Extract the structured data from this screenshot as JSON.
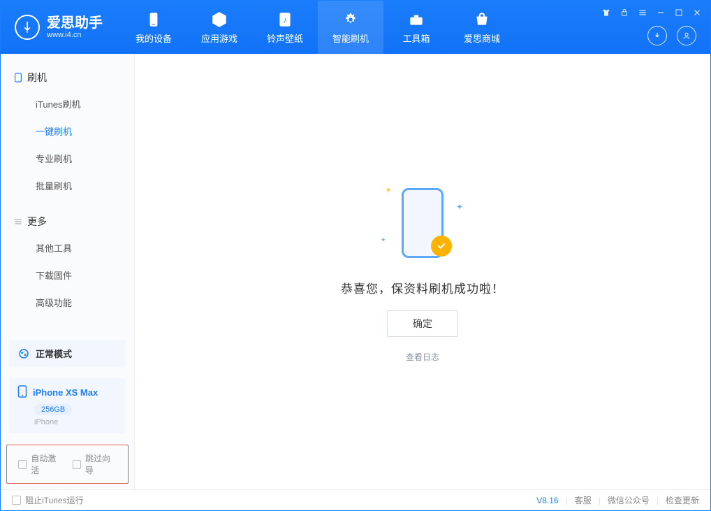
{
  "brand": {
    "name": "爱思助手",
    "site": "www.i4.cn"
  },
  "tabs": [
    {
      "label": "我的设备"
    },
    {
      "label": "应用游戏"
    },
    {
      "label": "铃声壁纸"
    },
    {
      "label": "智能刷机"
    },
    {
      "label": "工具箱"
    },
    {
      "label": "爱思商城"
    }
  ],
  "active_tab_index": 3,
  "sidebar": {
    "groups": [
      {
        "title": "刷机",
        "items": [
          "iTunes刷机",
          "一键刷机",
          "专业刷机",
          "批量刷机"
        ],
        "active_index": 1
      },
      {
        "title": "更多",
        "items": [
          "其他工具",
          "下载固件",
          "高级功能"
        ],
        "active_index": -1
      }
    ],
    "mode": "正常模式",
    "device": {
      "name": "iPhone XS Max",
      "storage": "256GB",
      "type": "iPhone"
    },
    "checkboxes": {
      "auto_activate": "自动激活",
      "skip_guide": "跳过向导"
    }
  },
  "main": {
    "success_message": "恭喜您，保资料刷机成功啦！",
    "ok_button": "确定",
    "view_log": "查看日志"
  },
  "footer": {
    "block_itunes": "阻止iTunes运行",
    "version": "V8.16",
    "links": [
      "客服",
      "微信公众号",
      "检查更新"
    ]
  },
  "colors": {
    "primary": "#1a7dfb",
    "highlight_border": "#e05a5a",
    "accent": "#ffb300"
  }
}
